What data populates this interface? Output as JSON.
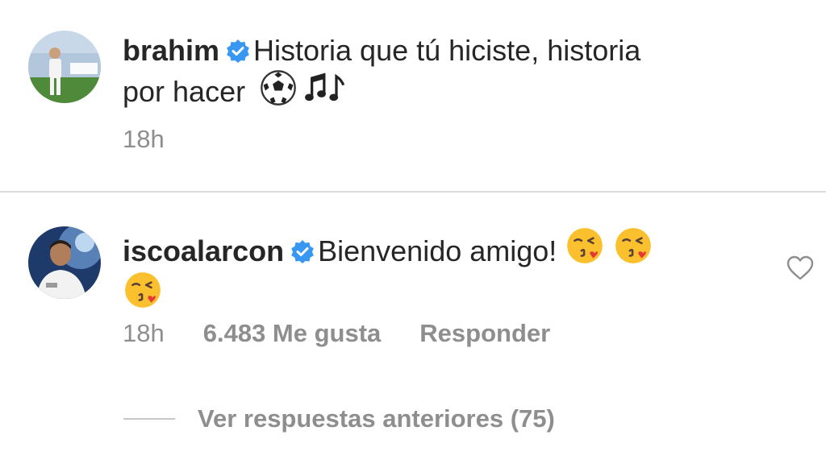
{
  "comments": [
    {
      "username": "brahim",
      "verified": true,
      "text_line1": "Historia que tú hiciste, historia",
      "text_line2": "por hacer",
      "emojis": [
        "soccer-ball",
        "musical-notes"
      ],
      "time": "18h"
    },
    {
      "username": "iscoalarcon",
      "verified": true,
      "text": "Bienvenido amigo!",
      "emojis": [
        "face-blowing-kiss",
        "face-blowing-kiss",
        "face-blowing-kiss"
      ],
      "time": "18h",
      "likes": "6.483 Me gusta",
      "reply": "Responder"
    }
  ],
  "view_replies": "Ver respuestas anteriores (75)",
  "colors": {
    "text": "#262626",
    "secondary": "#8e8e8e",
    "verified": "#3897f0",
    "divider": "#dbdbdb"
  }
}
